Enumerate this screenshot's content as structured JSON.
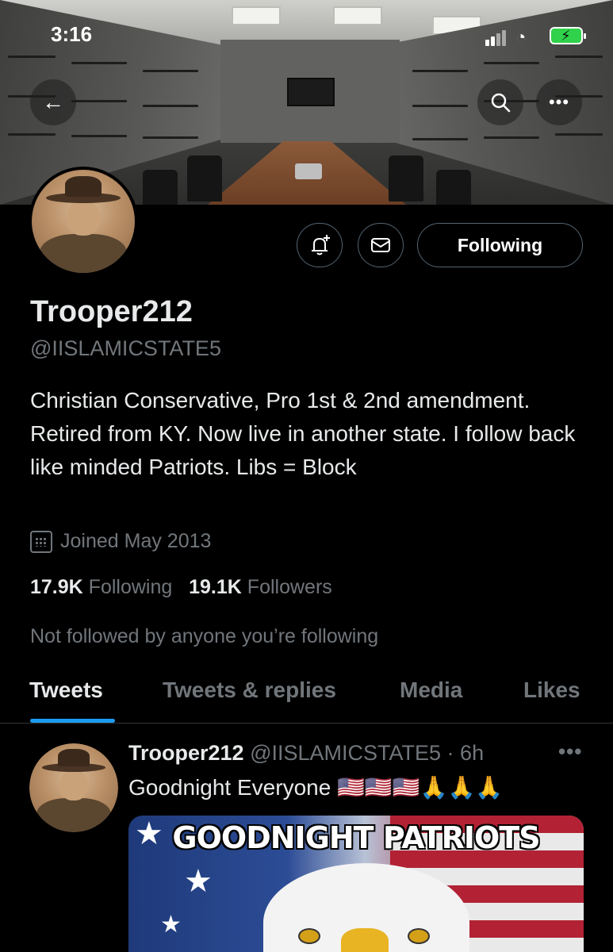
{
  "status_bar": {
    "time": "3:16"
  },
  "banner": {
    "back_icon": "arrow-left-icon",
    "search_icon": "search-icon",
    "more_icon": "more-horizontal-icon"
  },
  "profile": {
    "display_name": "Trooper212",
    "handle": "@IISLAMICSTATE5",
    "bio": "Christian Conservative, Pro 1st & 2nd amendment. Retired from KY. Now live in another state. I follow back like minded Patriots. Libs = Block",
    "joined": "Joined May 2013",
    "following_count": "17.9K",
    "following_label": "Following",
    "followers_count": "19.1K",
    "followers_label": "Followers",
    "not_followed_text": "Not followed by anyone you’re following",
    "follow_button_label": "Following"
  },
  "tabs": [
    {
      "label": "Tweets",
      "active": true
    },
    {
      "label": "Tweets & replies",
      "active": false
    },
    {
      "label": "Media",
      "active": false
    },
    {
      "label": "Likes",
      "active": false
    }
  ],
  "tweet": {
    "name": "Trooper212",
    "handle": "@IISLAMICSTATE5",
    "time": "6h",
    "text": "Goodnight Everyone",
    "emojis": "🇺🇸🇺🇸🇺🇸🙏🙏🙏",
    "image_caption": "GOODNIGHT PATRIOTS"
  },
  "colors": {
    "accent": "#1d9bf0",
    "muted": "#71767b",
    "text": "#e7e9ea",
    "background": "#000000"
  }
}
